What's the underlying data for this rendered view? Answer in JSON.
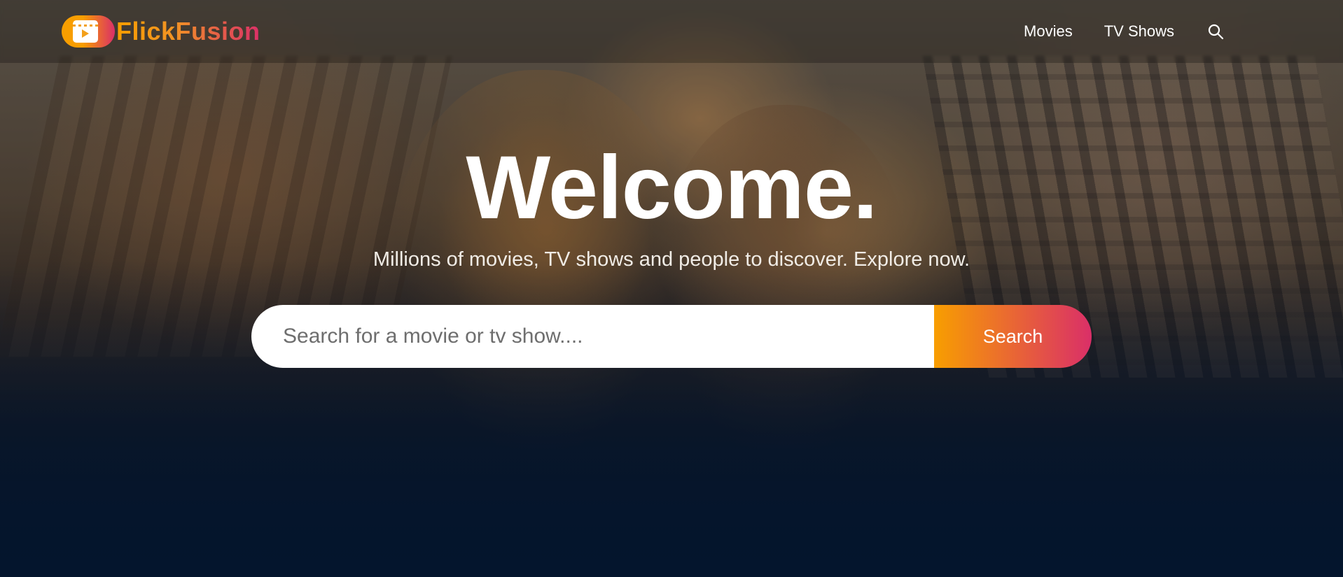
{
  "brand": {
    "name": "FlickFusion",
    "logo_icon": "clapperboard-play-icon",
    "gradient_start": "#f89e00",
    "gradient_end": "#da2f68"
  },
  "nav": {
    "items": [
      {
        "label": "Movies"
      },
      {
        "label": "TV Shows"
      }
    ],
    "search_icon": "search-icon"
  },
  "hero": {
    "title": "Welcome.",
    "subtitle": "Millions of movies, TV shows and people to discover. Explore now.",
    "search": {
      "placeholder": "Search for a movie or tv show....",
      "value": "",
      "button_label": "Search"
    }
  },
  "colors": {
    "background": "#04152d",
    "text": "#ffffff"
  }
}
